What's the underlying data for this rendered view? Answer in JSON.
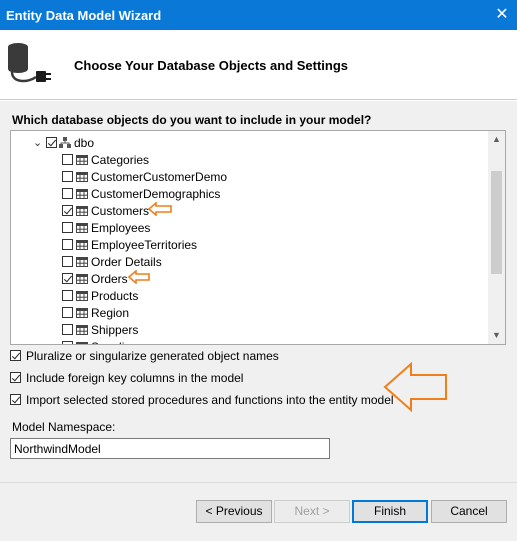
{
  "window": {
    "title": "Entity Data Model Wizard",
    "close_glyph": "✕"
  },
  "header": {
    "heading": "Choose Your Database Objects and Settings",
    "icon": "database-plug-icon"
  },
  "question": "Which database objects do you want to include in your model?",
  "tree": {
    "root": {
      "label": "dbo",
      "checked": true,
      "expanded": true
    },
    "items": [
      {
        "label": "Categories",
        "checked": false
      },
      {
        "label": "CustomerCustomerDemo",
        "checked": false
      },
      {
        "label": "CustomerDemographics",
        "checked": false
      },
      {
        "label": "Customers",
        "checked": true,
        "annotated": true
      },
      {
        "label": "Employees",
        "checked": false
      },
      {
        "label": "EmployeeTerritories",
        "checked": false
      },
      {
        "label": "Order Details",
        "checked": false
      },
      {
        "label": "Orders",
        "checked": true,
        "annotated": true
      },
      {
        "label": "Products",
        "checked": false
      },
      {
        "label": "Region",
        "checked": false
      },
      {
        "label": "Shippers",
        "checked": false
      },
      {
        "label": "Suppliers",
        "checked": false
      }
    ]
  },
  "options": [
    {
      "label": "Pluralize or singularize generated object names",
      "checked": true
    },
    {
      "label": "Include foreign key columns in the model",
      "checked": true
    },
    {
      "label": "Import selected stored procedures and functions into the entity model",
      "checked": true
    }
  ],
  "namespace": {
    "label": "Model Namespace:",
    "value": "NorthwindModel"
  },
  "buttons": {
    "previous": "< Previous",
    "next": "Next >",
    "finish": "Finish",
    "cancel": "Cancel"
  },
  "colors": {
    "titlebar": "#0a78d7",
    "annotation": "#f07f1a"
  }
}
